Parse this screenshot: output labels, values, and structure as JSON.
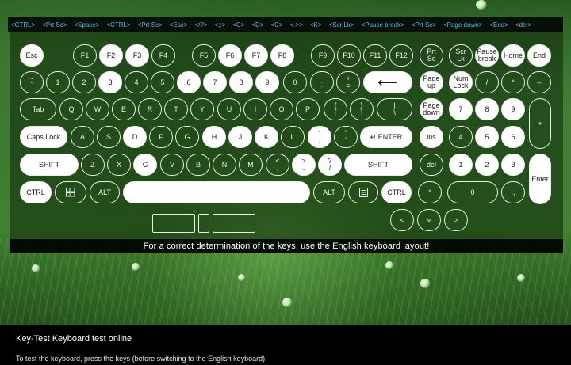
{
  "top_bar_keys": [
    "<CTRL>",
    "<Prt Sc>",
    "<Space>",
    "<CTRL>",
    "<Prt Sc>",
    "<Esc>",
    "</?>",
    "<;:>",
    "<C>",
    "<D>",
    "<C>",
    "<.>>",
    "<K>",
    "<Scr Lk>",
    "<Pause break>",
    "<Prt Sc>",
    "<Page down>",
    "<End>",
    "<del>"
  ],
  "keys": {
    "esc": "Esc",
    "f1": "F1",
    "f2": "F2",
    "f3": "F3",
    "f4": "F4",
    "f5": "F5",
    "f6": "F6",
    "f7": "F7",
    "f8": "F8",
    "f9": "F9",
    "f10": "F10",
    "f11": "F11",
    "f12": "F12",
    "prtsc_1": "Prt",
    "prtsc_2": "Sc",
    "scrlk_1": "Scr",
    "scrlk_2": "Lk",
    "pause_1": "Pause",
    "pause_2": "break",
    "home": "Home",
    "end": "End",
    "tilde_1": "~",
    "tilde_2": "`",
    "n1": "1",
    "n2": "2",
    "n3": "3",
    "n4": "4",
    "n5": "5",
    "n6": "6",
    "n7": "7",
    "n8": "8",
    "n9": "9",
    "n0": "0",
    "minus_1": "_",
    "minus_2": "–",
    "equal_1": "+",
    "equal_2": "=",
    "backspace": "⟵",
    "pgup_1": "Page",
    "pgup_2": "up",
    "numlock_1": "Num",
    "numlock_2": "Lock",
    "np_div": "/",
    "np_mul": "*",
    "np_sub": "–",
    "tab": "Tab",
    "q": "Q",
    "w": "W",
    "e": "E",
    "r": "R",
    "t": "T",
    "y": "Y",
    "u": "U",
    "i": "I",
    "o": "O",
    "p": "P",
    "lbr_1": "{",
    "lbr_2": "[",
    "rbr_1": "}",
    "rbr_2": "]",
    "bsl_1": "|",
    "bsl_2": "\\",
    "pgdn_1": "Page",
    "pgdn_2": "down",
    "np7": "7",
    "np8": "8",
    "np9": "9",
    "np_add": "+",
    "caps": "Caps Lock",
    "a": "A",
    "s": "S",
    "d": "D",
    "f": "F",
    "g": "G",
    "h": "H",
    "j": "J",
    "k": "K",
    "l": "L",
    "semi_1": ":",
    "semi_2": ";",
    "quote_1": "\"",
    "quote_2": "'",
    "enter": "↵ ENTER",
    "ins": "ins",
    "np4": "4",
    "np5": "5",
    "np6": "6",
    "lshift": "SHIFT",
    "z": "Z",
    "x": "X",
    "c": "C",
    "v": "V",
    "b": "B",
    "n": "N",
    "m": "M",
    "comma_1": "<",
    "comma_2": ",",
    "period_1": ">",
    "period_2": ".",
    "slash_1": "?",
    "slash_2": "/",
    "rshift": "SHIFT",
    "del": "del",
    "np1": "1",
    "np2": "2",
    "np3": "3",
    "np_enter": "Enter",
    "lctrl": "CTRL",
    "lalt": "ALT",
    "ralt": "ALT",
    "rctrl": "CTRL",
    "arrow_up": "^",
    "np0": "0",
    "np_dot": ".,",
    "arrow_left": "<",
    "arrow_down": "v",
    "arrow_right": ">"
  },
  "note": "For a correct determination of the keys, use the English keyboard layout!",
  "footer": {
    "title": "Key-Test Keyboard test online",
    "text": "To test the keyboard, press the keys (before switching to the English keyboard)"
  }
}
